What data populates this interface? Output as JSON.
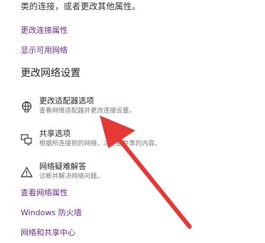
{
  "top_clipped_text": "类的连接，或者更改其他属性。",
  "links": {
    "change_connection_properties": "更改连接属性",
    "show_available_networks": "显示可用网络",
    "view_network_properties": "查看网络属性",
    "windows_firewall": "Windows 防火墙",
    "network_sharing_center": "网络和共享中心"
  },
  "section_title": "更改网络设置",
  "options": [
    {
      "title": "更改适配器选项",
      "desc": "查看网络适配器并更改连接设置。",
      "icon": "network-adapter-icon"
    },
    {
      "title": "共享选项",
      "desc": "根据所连接到的网络，决定要共享的内容。",
      "icon": "sharing-icon"
    },
    {
      "title": "网络疑难解答",
      "desc": "诊断并解决网络问题。",
      "icon": "warning-icon"
    }
  ],
  "annotation": {
    "color": "#e53935"
  }
}
